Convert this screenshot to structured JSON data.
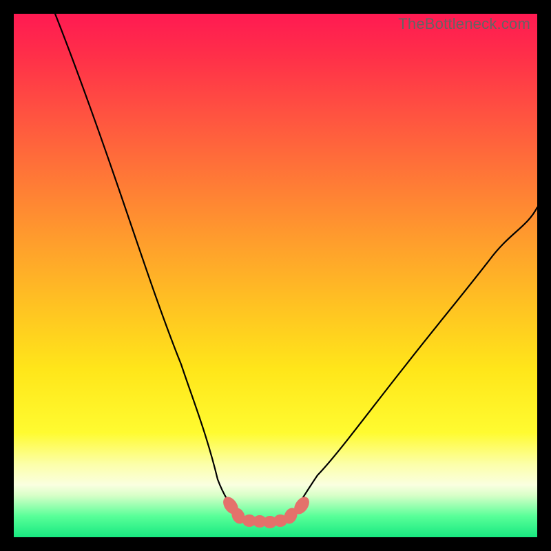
{
  "watermark": {
    "text": "TheBottleneck.com"
  },
  "chart_data": {
    "type": "line",
    "title": "",
    "xlabel": "",
    "ylabel": "",
    "xlim": [
      0,
      100
    ],
    "ylim": [
      0,
      100
    ],
    "grid": false,
    "legend": false,
    "annotations": [],
    "series": [
      {
        "name": "left-curve",
        "x": [
          8,
          12,
          16,
          20,
          24,
          28,
          32,
          36,
          39,
          41.5,
          43
        ],
        "values": [
          100,
          90,
          79,
          67,
          55,
          43,
          31,
          20,
          11,
          6,
          4
        ]
      },
      {
        "name": "right-curve",
        "x": [
          53,
          55,
          58,
          62,
          68,
          75,
          83,
          91,
          100
        ],
        "values": [
          4,
          6,
          10,
          16,
          24,
          33,
          43,
          53,
          63
        ]
      },
      {
        "name": "valley-floor",
        "x": [
          43,
          45,
          47,
          49,
          51,
          53
        ],
        "values": [
          4,
          3.2,
          3,
          3,
          3.2,
          4
        ]
      }
    ],
    "markers": {
      "name": "salmon-blobs",
      "color": "#e4716b",
      "points": [
        {
          "x": 41.5,
          "y": 6
        },
        {
          "x": 43,
          "y": 4
        },
        {
          "x": 45,
          "y": 3.2
        },
        {
          "x": 47,
          "y": 3
        },
        {
          "x": 49,
          "y": 3
        },
        {
          "x": 51,
          "y": 3.2
        },
        {
          "x": 53,
          "y": 4
        },
        {
          "x": 55,
          "y": 6
        }
      ]
    },
    "background_gradient": {
      "top": "#ff1a52",
      "mid": "#ffe61a",
      "bottom": "#18e880"
    }
  }
}
